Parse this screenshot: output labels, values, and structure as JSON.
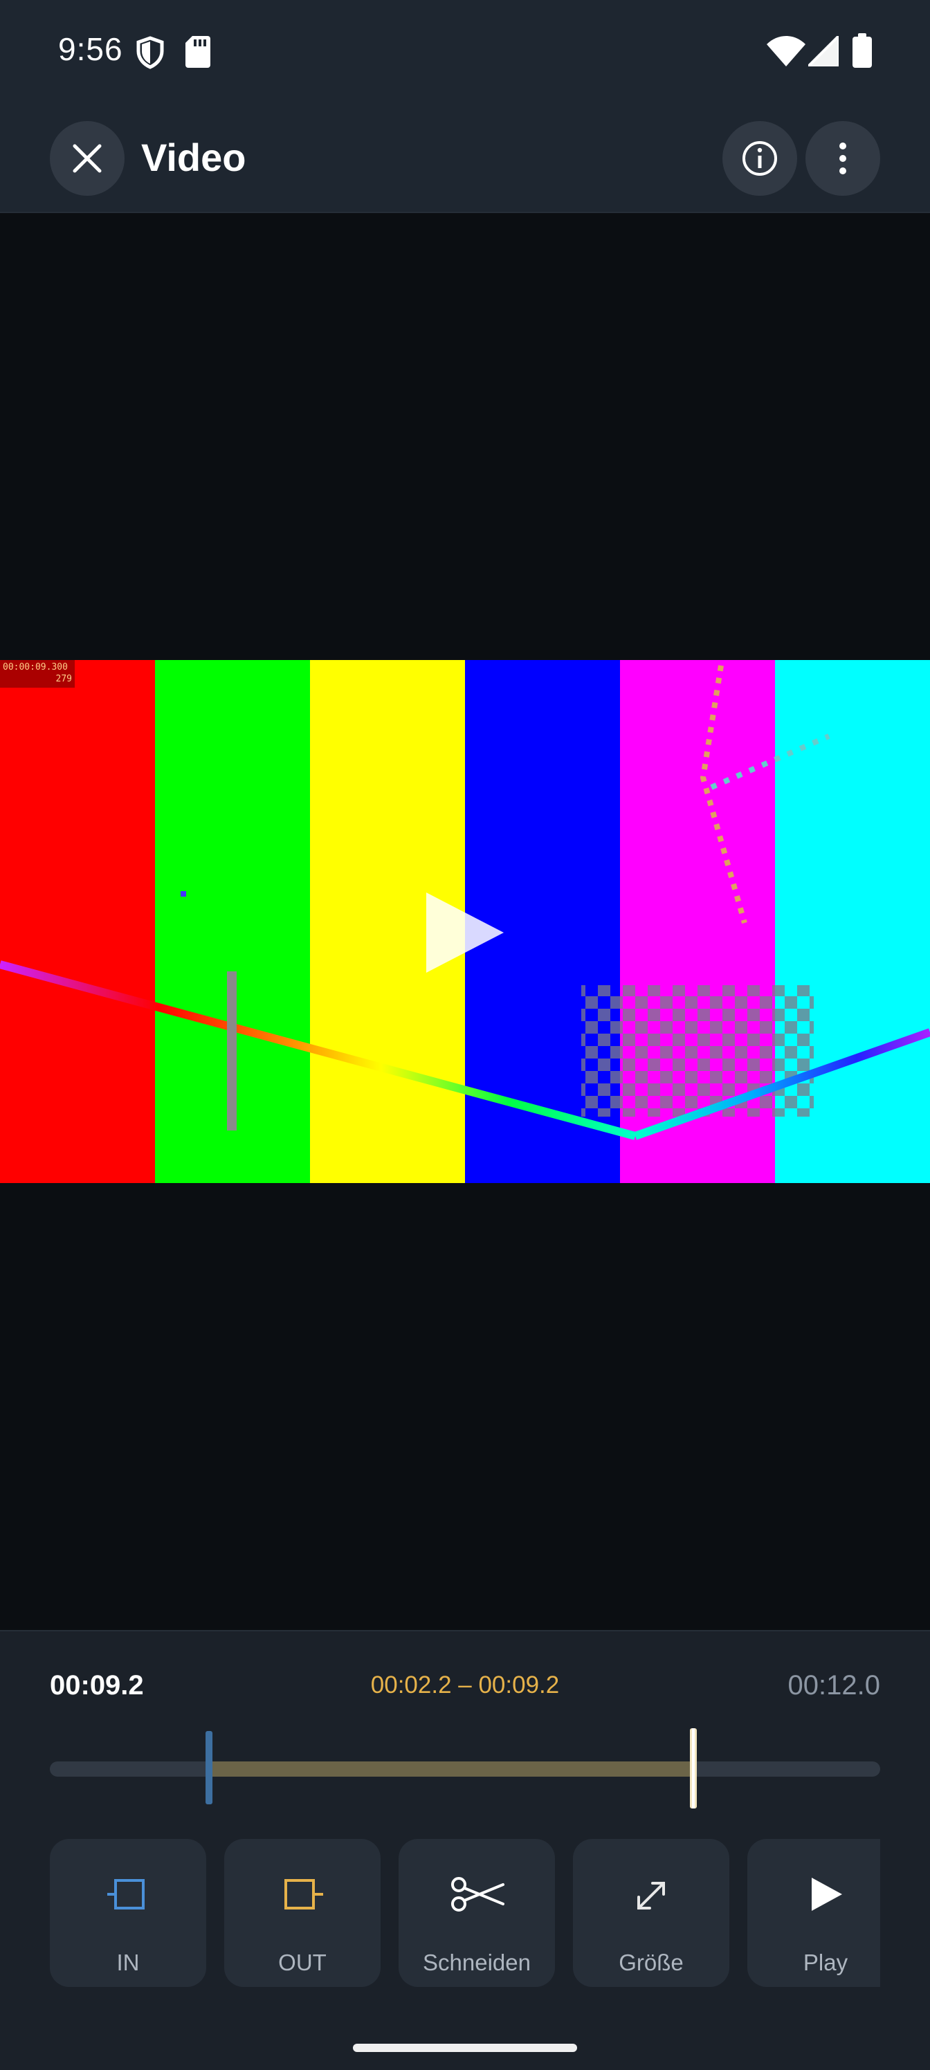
{
  "status_bar": {
    "time": "9:56",
    "icons": [
      "shield-icon",
      "sd-card-icon",
      "wifi-icon",
      "signal-icon",
      "battery-icon"
    ]
  },
  "app_bar": {
    "title": "Video",
    "close_icon": "close-icon",
    "info_icon": "info-icon",
    "more_icon": "more-vert-icon"
  },
  "video": {
    "overlay_timecode": "00:00:09.300",
    "overlay_frame": "279",
    "play_icon": "play-icon",
    "colors": [
      "#ff0000",
      "#00ff00",
      "#ffff00",
      "#0000ff",
      "#ff00ff",
      "#00ffff"
    ]
  },
  "timeline": {
    "current": "00:09.2",
    "range": "00:02.2 – 00:09.2",
    "total": "00:12.0",
    "in_fraction": 0.1917,
    "out_fraction": 0.775,
    "playhead_fraction": 0.775
  },
  "tools": [
    {
      "label": "IN",
      "icon": "in-marker-icon"
    },
    {
      "label": "OUT",
      "icon": "out-marker-icon"
    },
    {
      "label": "Schneiden",
      "icon": "scissors-icon"
    },
    {
      "label": "Größe",
      "icon": "resize-icon"
    },
    {
      "label": "Play",
      "icon": "play-icon"
    }
  ],
  "colors": {
    "accent_in": "#4a90d9",
    "accent_out": "#e6b24a",
    "background": "#1b2129"
  }
}
